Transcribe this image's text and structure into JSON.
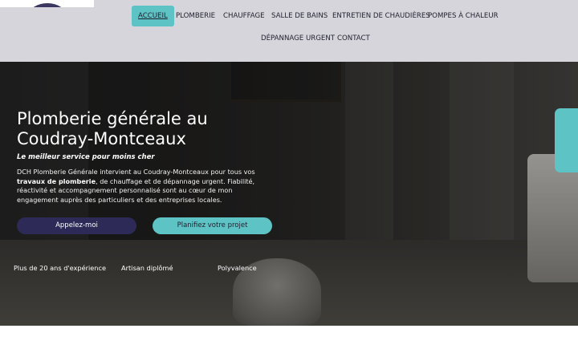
{
  "nav": {
    "items": [
      {
        "label": "ACCUEIL",
        "active": true
      },
      {
        "label": "PLOMBERIE"
      },
      {
        "label": "CHAUFFAGE"
      },
      {
        "label": "SALLE DE BAINS"
      },
      {
        "label": "ENTRETIEN DE CHAUDIÈRES"
      },
      {
        "label": "POMPES À CHALEUR"
      },
      {
        "label": "DÉPANNAGE URGENT"
      },
      {
        "label": "CONTACT"
      }
    ]
  },
  "hero": {
    "title": "Plomberie générale au Coudray-Montceaux",
    "subtitle": "Le meilleur service pour moins cher",
    "description_pre": "DCH Plomberie Générale intervient au Coudray-Montceaux pour tous vos ",
    "description_bold": "travaux de plomberie",
    "description_post": ", de chauffage et de dépannage urgent. Fiabilité, réactivité et accompagnement personnalisé sont au cœur de mon engagement auprès des particuliers et des entreprises locales.",
    "buttons": {
      "call": "Appelez-moi",
      "plan": "Planifiez votre projet"
    },
    "features": [
      "Plus de 20 ans d'expérience",
      "Artisan diplômé",
      "Polyvalence"
    ]
  },
  "colors": {
    "accent": "#5ec3c4",
    "primary": "#2d2a57",
    "header_bg": "#d6d5db"
  },
  "icons": {
    "side_tab": "side-tab-icon"
  }
}
